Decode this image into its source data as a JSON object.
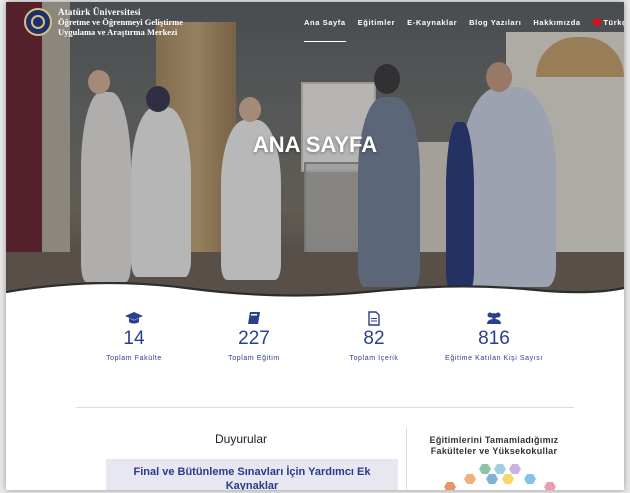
{
  "header": {
    "brand_line1": "Atatürk Üniversitesi",
    "brand_line2": "Öğretme ve Öğrenmeyi Geliştirme",
    "brand_line3": "Uygulama ve Araştırma Merkezi",
    "logo_icon": "university-seal-icon"
  },
  "nav": {
    "items": [
      {
        "label": "Ana Sayfa",
        "active": true
      },
      {
        "label": "Eğitimler"
      },
      {
        "label": "E-Kaynaklar"
      },
      {
        "label": "Blog Yazıları"
      },
      {
        "label": "Hakkımızda"
      }
    ],
    "language": "Türkçe",
    "language_icon": "turkey-flag-icon"
  },
  "hero": {
    "title": "ANA SAYFA"
  },
  "stats": [
    {
      "icon": "graduation-cap-icon",
      "value": "14",
      "label": "Toplam Fakülte"
    },
    {
      "icon": "book-icon",
      "value": "227",
      "label": "Toplam Eğitim"
    },
    {
      "icon": "document-icon",
      "value": "82",
      "label": "Toplam İçerik"
    },
    {
      "icon": "users-icon",
      "value": "816",
      "label": "Eğitime Katılan Kişi Sayısı"
    }
  ],
  "announcements": {
    "title": "Duyurular",
    "first_card": "Final ve Bütünleme Sınavları İçin Yardımcı Ek Kaynaklar"
  },
  "sidebar": {
    "title": "Eğitimlerini Tamamladığımız Fakülteler ve Yüksekokullar"
  },
  "colors": {
    "accent": "#2a3f8f",
    "card_bg": "#e6e7f1"
  }
}
